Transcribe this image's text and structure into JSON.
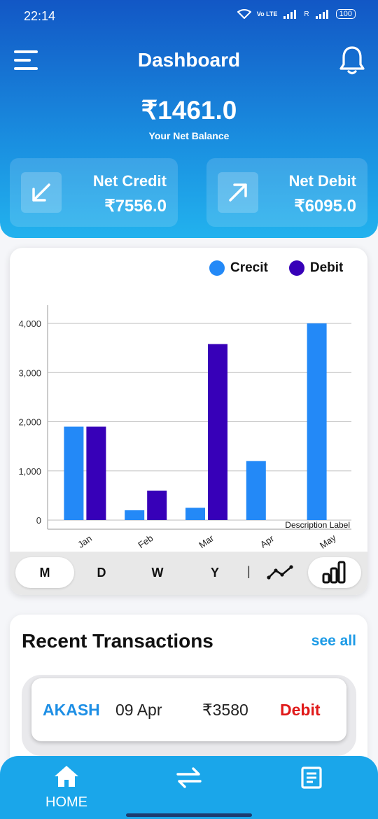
{
  "status_bar": {
    "time": "22:14",
    "network": "Vo LTE",
    "signal": "R",
    "battery": "100"
  },
  "header": {
    "title": "Dashboard",
    "balance": "₹1461.0",
    "balance_label": "Your Net Balance",
    "menu_icon": "hamburger-menu-icon",
    "bell_icon": "bell-icon"
  },
  "cards": {
    "credit": {
      "label": "Net Credit",
      "value": "₹7556.0",
      "icon": "arrow-down-left-icon"
    },
    "debit": {
      "label": "Net Debit",
      "value": "₹6095.0",
      "icon": "arrow-up-right-icon"
    }
  },
  "colors": {
    "credit": "#2389f7",
    "debit": "#3700b8",
    "header_top": "#1257c5",
    "header_bottom": "#22b2ee",
    "nav": "#1aa6ea"
  },
  "chart_data": {
    "type": "bar",
    "categories": [
      "Jan",
      "Feb",
      "Mar",
      "Apr",
      "May"
    ],
    "series": [
      {
        "name": "Crecit",
        "values": [
          1900,
          200,
          250,
          1200,
          4000
        ]
      },
      {
        "name": "Debit",
        "values": [
          1900,
          600,
          3580,
          0,
          0
        ]
      }
    ],
    "yticks": [
      "0",
      "1,000",
      "2,000",
      "3,000",
      "4,000"
    ],
    "ylim": [
      0,
      4000
    ],
    "description": "Description Label",
    "grid": true,
    "legend": "top-right"
  },
  "range_toggle": {
    "options": [
      "M",
      "D",
      "W",
      "Y"
    ],
    "active": "M",
    "separator": "|",
    "line_icon": "line-chart-icon",
    "bar_icon": "bar-chart-icon"
  },
  "recent": {
    "title": "Recent Transactions",
    "see_all": "see all",
    "transactions": [
      {
        "name": "AKASH",
        "date": "09 Apr",
        "amount": "₹3580",
        "type": "Debit"
      }
    ]
  },
  "bottom_nav": {
    "home_label": "HOME",
    "home_icon": "home-icon",
    "transfer_icon": "transfer-arrows-icon",
    "report_icon": "document-icon"
  }
}
